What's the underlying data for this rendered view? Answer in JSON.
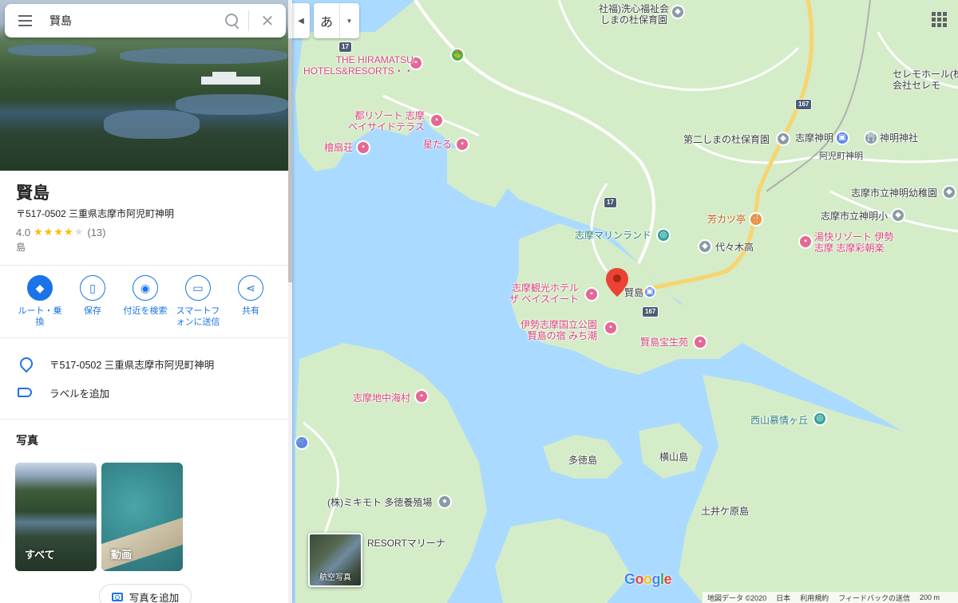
{
  "search": {
    "query": "賢島"
  },
  "place": {
    "title": "賢島",
    "address": "〒517-0502 三重県志摩市阿児町神明",
    "rating": "4.0",
    "stars_value": 4,
    "stars_max": 5,
    "review_count": "(13)",
    "category": "島"
  },
  "actions": [
    {
      "label": "ルート・乗換",
      "icon": "directions-icon"
    },
    {
      "label": "保存",
      "icon": "bookmark-icon"
    },
    {
      "label": "付近を検索",
      "icon": "nearby-search-icon"
    },
    {
      "label": "スマートフォンに送信",
      "icon": "send-to-phone-icon"
    },
    {
      "label": "共有",
      "icon": "share-icon"
    }
  ],
  "info": {
    "address": "〒517-0502 三重県志摩市阿児町神明",
    "add_label": "ラベルを追加"
  },
  "photos": {
    "title": "写真",
    "items": [
      {
        "label": "すべて"
      },
      {
        "label": "動画"
      }
    ],
    "add_button": "写真を追加"
  },
  "map": {
    "language_button": "あ",
    "satellite_label": "航空写真",
    "google_logo": "Google",
    "places": {
      "hiramatsu": "THE HIRAMATSU\nHOTELS&RESORTS・・",
      "miyako": "都リゾート 志摩\nベイサイドテラス",
      "kaisen": "檜扇荘",
      "hoshitaru": "星たる",
      "kankou": "志摩観光ホテル\nザ ベイスイート",
      "ise_park": "伊勢志摩国立公園\n賢島の宿 みち潮",
      "kashikojima_station": "賢島",
      "kashikojima_houseiso": "賢島宝生苑",
      "marineland": "志摩マリンランド",
      "yoyogi": "代々木高",
      "hokatsu": "芳カツ亭",
      "yuraku": "湯快リゾート 伊勢\n志摩 志摩彩朝楽",
      "chichukai": "志摩地中海村",
      "nishiyama": "西山慕情ヶ丘",
      "tatoku": "多徳島",
      "yokoyama": "横山島",
      "mikimoto": "(株)ミキモト 多徳養殖場",
      "resort_marina": "RESORTマリーナ",
      "doigahara": "土井ケ原島",
      "shinmei_station": "志摩神明",
      "shinmei_shrine": "神明神社",
      "shinmei_label": "阿児町神明",
      "daini_hoikuen": "第二しまの杜保育園",
      "shinmei_kinder": "志摩市立神明幼稚園",
      "shinmei_elem": "志摩市立神明小",
      "shakai": "社福)洗心福祉会\nしまの杜保育園",
      "seremo": "セレモホール(株\n会社セレモ",
      "route_167a": "167",
      "route_167b": "167",
      "route_17a": "17",
      "route_17b": "17",
      "route_167c": "167"
    },
    "footer": [
      "地図データ ©2020",
      "日本",
      "利用規約",
      "フィードバックの送信",
      "200 m"
    ],
    "colors": {
      "water": "#aadaff",
      "land": "#d4ecc8",
      "road": "#ffffff",
      "highway": "#f8d46f",
      "marker": "#ea4335"
    }
  }
}
